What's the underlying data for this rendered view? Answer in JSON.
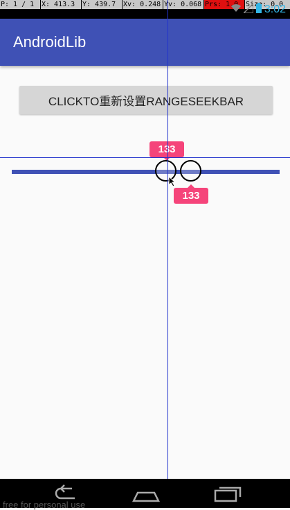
{
  "debug_bar": {
    "pointer": "P: 1 / 1",
    "x": "X: 413.3",
    "y": "Y: 439.7",
    "xv": "Xv: 0.248",
    "yv": "Yv: 0.068",
    "prs": "Prs: 1.0",
    "size": "Size: 0.0"
  },
  "status_bar": {
    "time": "3:02",
    "icons": [
      "wifi-icon",
      "signal-icon",
      "battery-icon"
    ]
  },
  "app_bar": {
    "title": "AndroidLib"
  },
  "reset_button": {
    "label": "CLICKTO重新设置RANGESEEKBAR"
  },
  "range_seekbar": {
    "min_value_label": "133",
    "max_value_label": "133"
  },
  "nav_bar": {
    "icons": [
      "back-icon",
      "home-icon",
      "recent-apps-icon"
    ]
  },
  "watermark": {
    "text": "free for personal use"
  },
  "colors": {
    "primary": "#3f51b5",
    "tooltip": "#f5447a",
    "crosshair": "#2233cc"
  }
}
